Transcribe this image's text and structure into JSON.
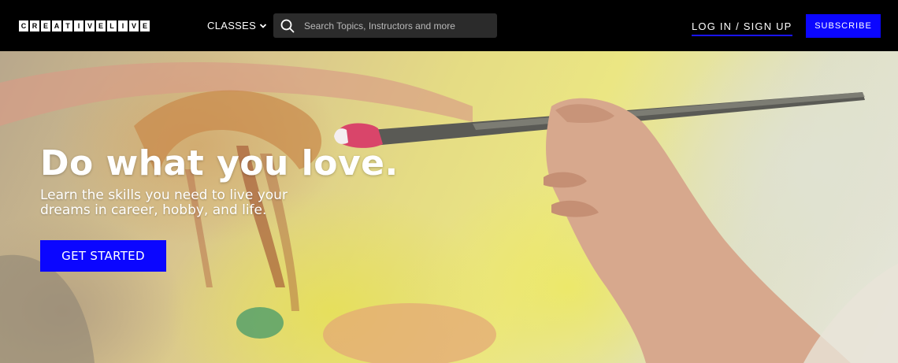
{
  "header": {
    "logo_text": "CREATIVELIVE",
    "classes_label": "CLASSES",
    "search_placeholder": "Search Topics, Instructors and more",
    "login_label": "LOG IN / SIGN UP",
    "subscribe_label": "SUBSCRIBE"
  },
  "hero": {
    "headline": "Do what you love.",
    "subline": "Learn the skills you need to live your dreams in career, hobby, and life.",
    "cta_label": "GET STARTED"
  },
  "colors": {
    "brand_blue": "#0b06ff",
    "header_bg": "#000000",
    "search_bg": "#2b2b2b"
  },
  "icons": {
    "search": "search-icon",
    "chevron": "chevron-down-icon"
  }
}
